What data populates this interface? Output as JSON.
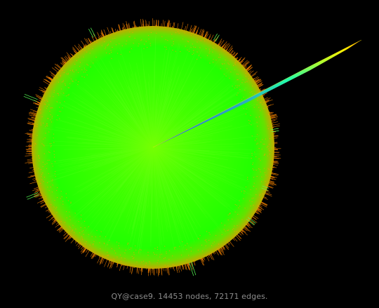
{
  "caption": "QY@case9. 14453 nodes, 72171 edges.",
  "colors": {
    "background": "#000000",
    "core": "#66ff00",
    "body": "#22ff00",
    "rim": "#ff8800",
    "spoke_start": "#2a6fd6",
    "spoke_mid": "#22ffaa",
    "spoke_end": "#ffee00",
    "caption": "#8c8c8c"
  }
}
